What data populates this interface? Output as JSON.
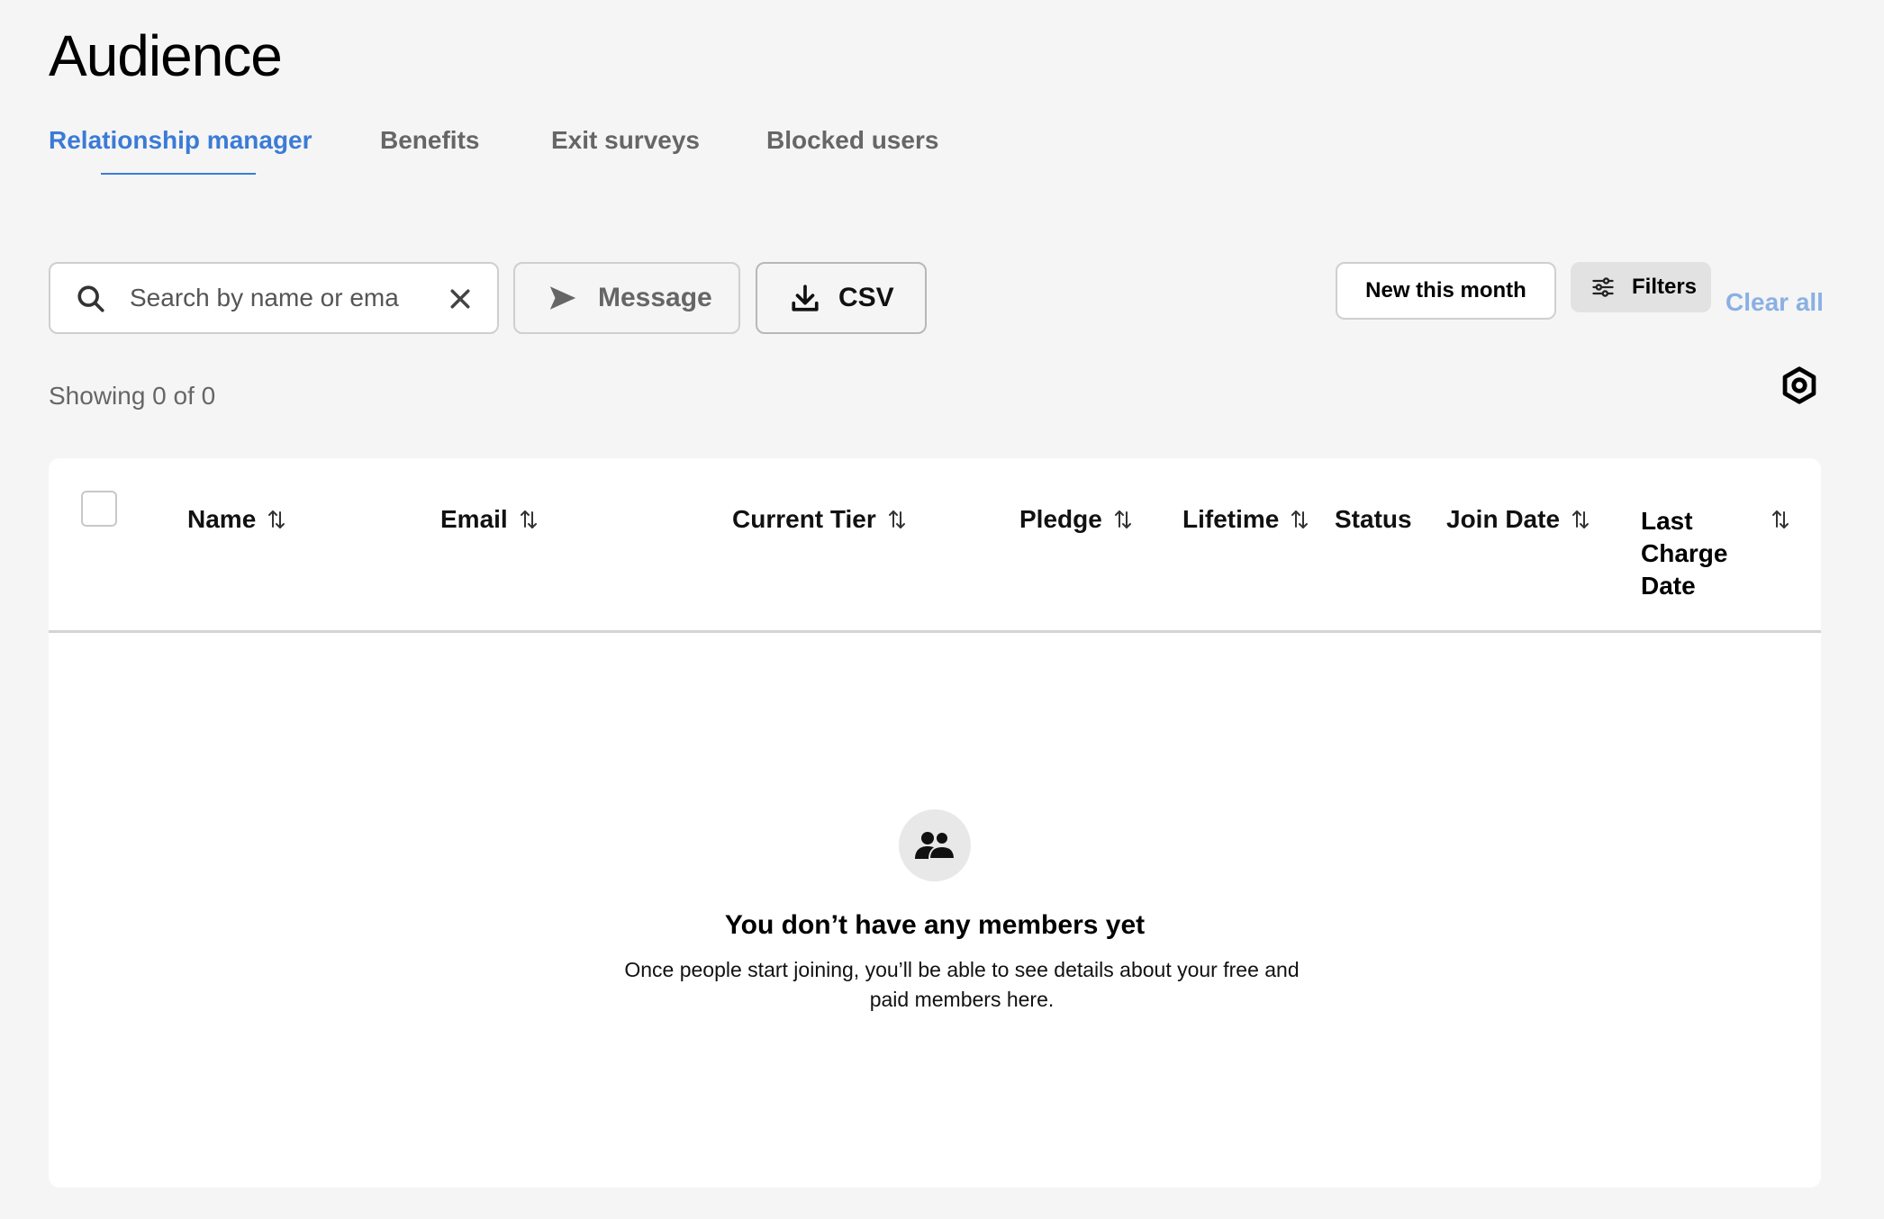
{
  "page": {
    "title": "Audience"
  },
  "tabs": [
    {
      "label": "Relationship manager",
      "active": true
    },
    {
      "label": "Benefits",
      "active": false
    },
    {
      "label": "Exit surveys",
      "active": false
    },
    {
      "label": "Blocked users",
      "active": false
    }
  ],
  "toolbar": {
    "search_placeholder": "Search by name or email",
    "message_label": "Message",
    "csv_label": "CSV",
    "new_this_month_label": "New this month",
    "filters_label": "Filters",
    "clear_all_label": "Clear all"
  },
  "summary": {
    "showing": "Showing 0 of 0"
  },
  "table": {
    "columns": [
      {
        "label": "Name",
        "sortable": true
      },
      {
        "label": "Email",
        "sortable": true
      },
      {
        "label": "Current Tier",
        "sortable": true
      },
      {
        "label": "Pledge",
        "sortable": true
      },
      {
        "label": "Lifetime",
        "sortable": true
      },
      {
        "label": "Status",
        "sortable": false
      },
      {
        "label": "Join Date",
        "sortable": true
      },
      {
        "label": "Last Charge Date",
        "sortable": true
      }
    ],
    "rows": []
  },
  "empty_state": {
    "icon": "members-icon",
    "title": "You don’t have any members yet",
    "description": "Once people start joining, you’ll be able to see details about your free and paid members here."
  },
  "colors": {
    "accent": "#3b7bd6",
    "clear_all": "#8ab0e3",
    "background": "#f5f5f5",
    "card": "#ffffff"
  }
}
